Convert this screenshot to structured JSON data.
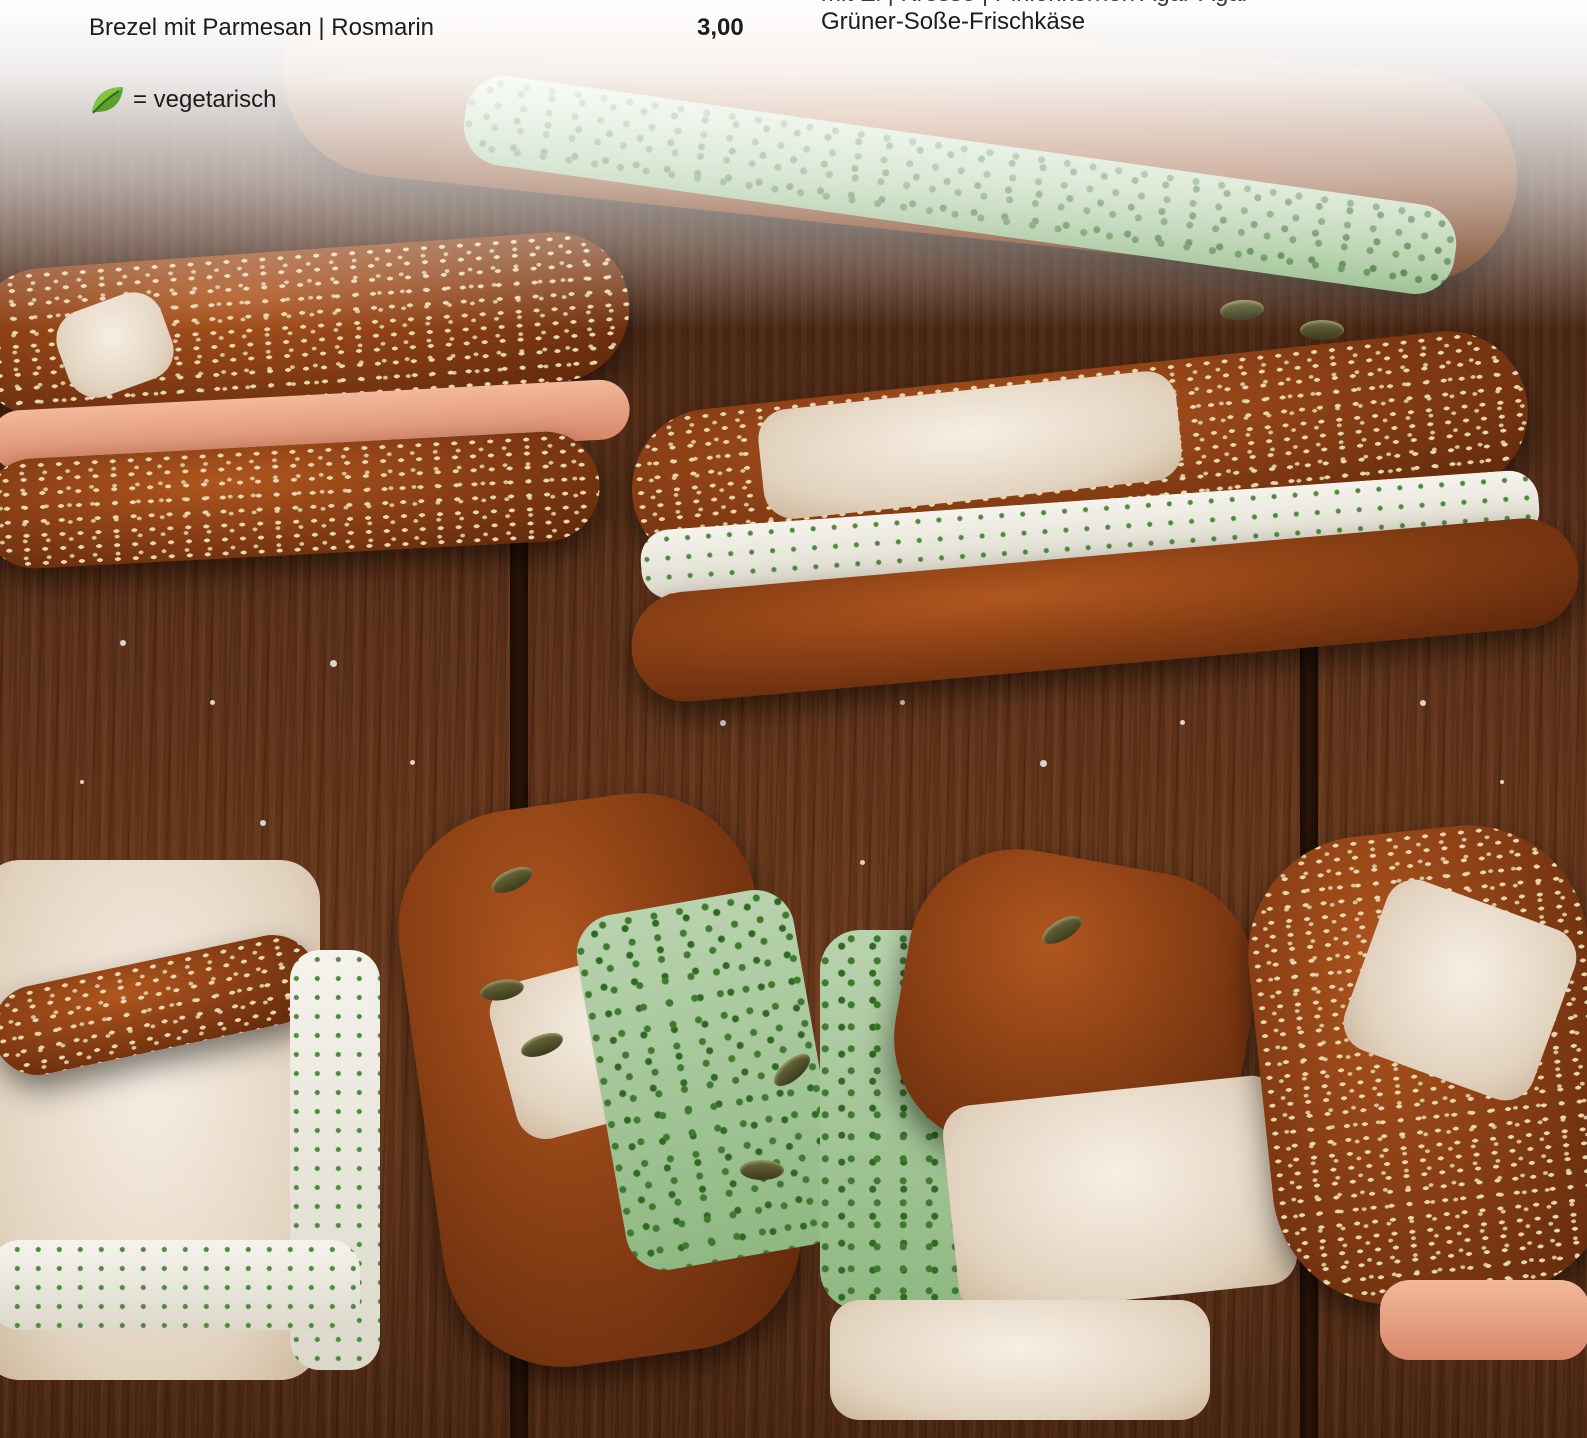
{
  "menu": {
    "item": {
      "name": "Brezel mit Parmesan | Rosmarin",
      "price": "3,00",
      "description": "Grüner-Soße-Frischkäse",
      "description_above_clipped": "mit Ei | Kresse | Pinienkernen Agar-Agar"
    },
    "legend": {
      "icon": "leaf-icon",
      "label": "= vegetarisch",
      "icon_color": "#5aa02c"
    }
  },
  "photo": {
    "subject": "pretzel-sandwiches-photo"
  }
}
